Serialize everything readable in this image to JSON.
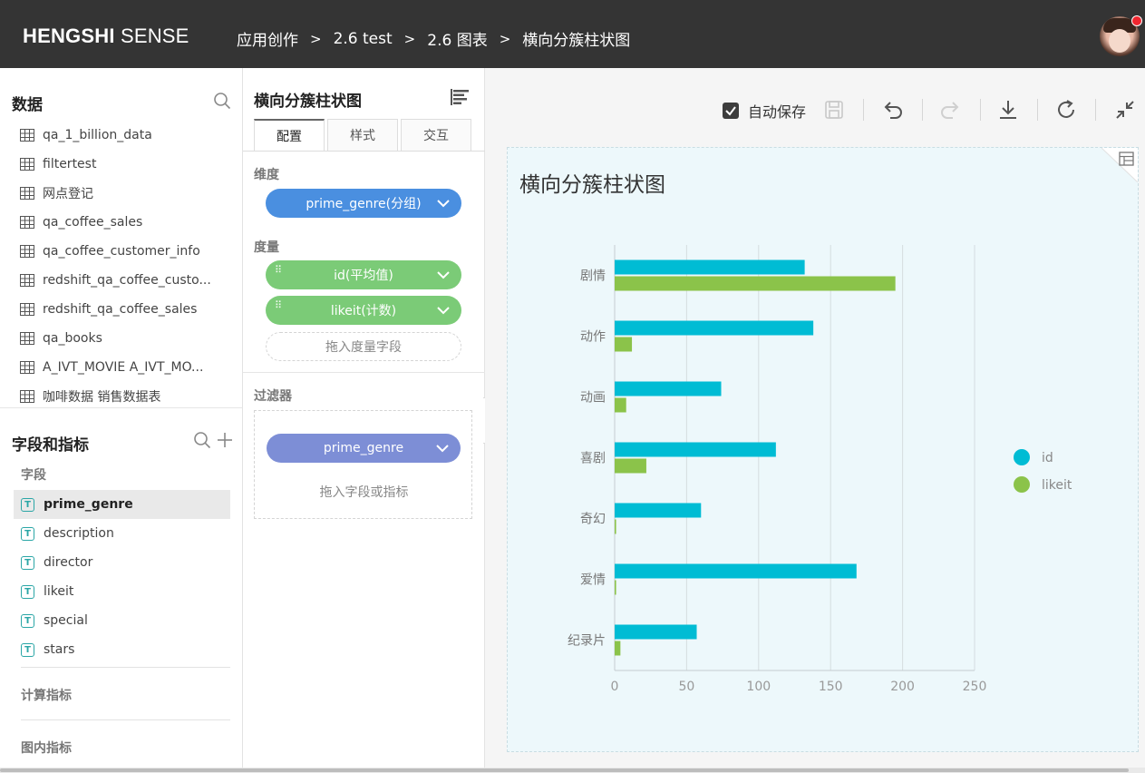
{
  "header": {
    "brand_bold": "HENGSHI",
    "brand_light": "SENSE",
    "breadcrumb": [
      "应用创作",
      "2.6 test",
      "2.6 图表",
      "横向分簇柱状图"
    ],
    "separator": ">"
  },
  "data_panel": {
    "title": "数据",
    "tables": [
      "qa_1_billion_data",
      "filtertest",
      "网点登记",
      "qa_coffee_sales",
      "qa_coffee_customer_info",
      "redshift_qa_coffee_custo...",
      "redshift_qa_coffee_sales",
      "qa_books",
      "A_IVT_MOVIE A_IVT_MO...",
      "咖啡数据 销售数据表"
    ]
  },
  "fields_panel": {
    "title": "字段和指标",
    "fields_label": "字段",
    "field_badge": "T",
    "fields": [
      "prime_genre",
      "description",
      "director",
      "likeit",
      "special",
      "stars"
    ],
    "selected_field": "prime_genre",
    "calc_label": "计算指标",
    "inner_label": "图内指标"
  },
  "config": {
    "title": "横向分簇柱状图",
    "tabs": [
      "配置",
      "样式",
      "交互"
    ],
    "active_tab": "配置",
    "dimension_label": "维度",
    "dimension_pill": "prime_genre(分组)",
    "measure_label": "度量",
    "measure_pills": [
      "id(平均值)",
      "likeit(计数)"
    ],
    "measure_drop_hint": "拖入度量字段",
    "filter_label": "过滤器",
    "filter_pill": "prime_genre",
    "filter_drop_hint": "拖入字段或指标"
  },
  "toolbar": {
    "autosave_label": "自动保存",
    "autosave_checked": true
  },
  "colors": {
    "id": "#00bcd4",
    "likeit": "#8bc34a",
    "dimension_pill": "#4a8fe0",
    "measure_pill": "#7bcb77",
    "filter_pill": "#7d8ed6"
  },
  "chart_data": {
    "type": "bar",
    "orientation": "horizontal",
    "title": "横向分簇柱状图",
    "categories": [
      "剧情",
      "动作",
      "动画",
      "喜剧",
      "奇幻",
      "爱情",
      "纪录片"
    ],
    "series": [
      {
        "name": "id",
        "values": [
          132,
          138,
          74,
          112,
          60,
          168,
          57
        ]
      },
      {
        "name": "likeit",
        "values": [
          195,
          12,
          8,
          22,
          1,
          1,
          4
        ]
      }
    ],
    "xlim": [
      0,
      250
    ],
    "xticks": [
      "0",
      "50",
      "100",
      "150",
      "200",
      "250"
    ],
    "grid": true,
    "legend": "right"
  }
}
